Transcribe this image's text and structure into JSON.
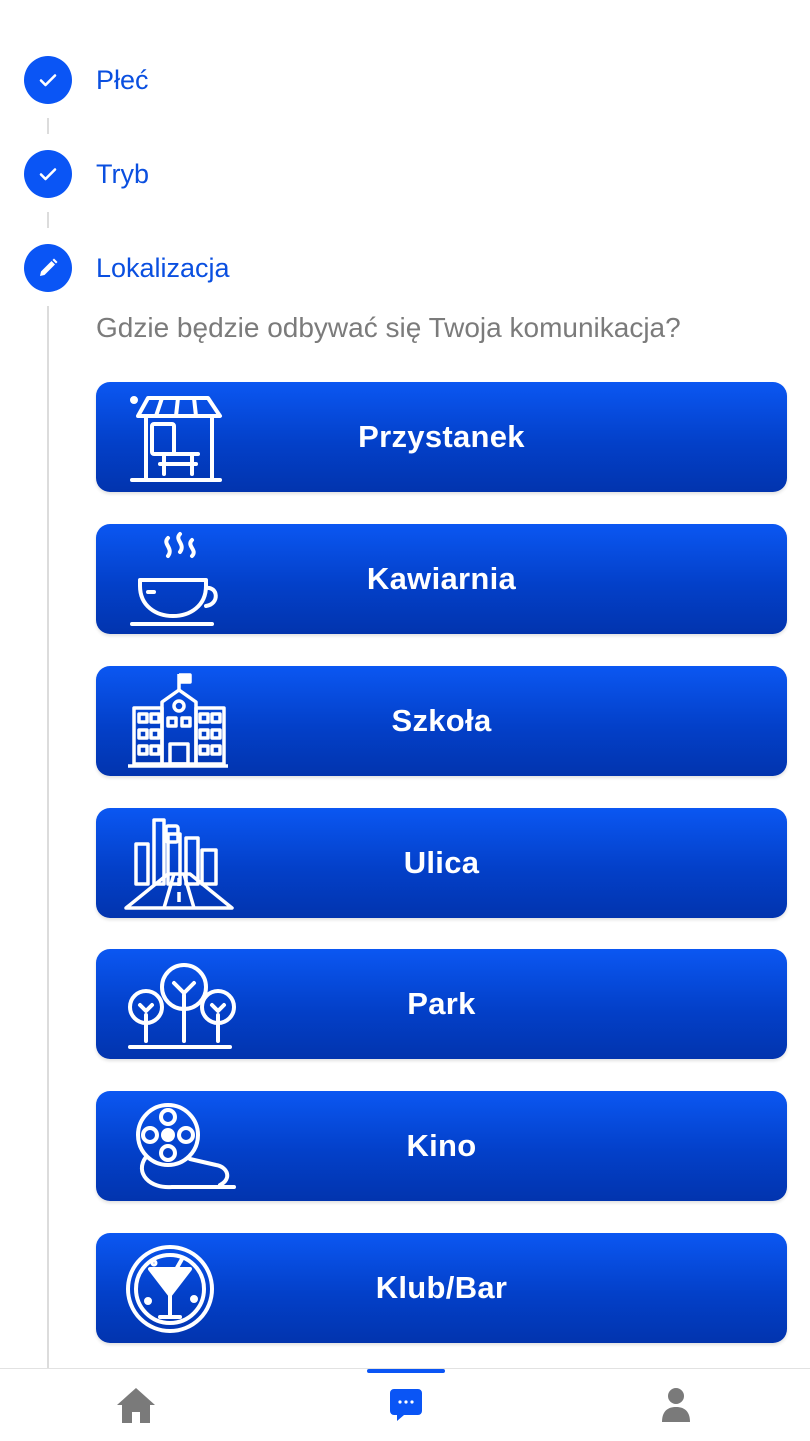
{
  "steps": [
    {
      "label": "Płeć",
      "state": "done",
      "icon": "check-icon"
    },
    {
      "label": "Tryb",
      "state": "done",
      "icon": "check-icon"
    },
    {
      "label": "Lokalizacja",
      "state": "current",
      "icon": "pencil-icon"
    }
  ],
  "question": "Gdzie będzie odbywać się Twoja komunikacja?",
  "options": [
    {
      "label": "Przystanek",
      "icon": "bus-stop-icon"
    },
    {
      "label": "Kawiarnia",
      "icon": "coffee-cup-icon"
    },
    {
      "label": "Szkoła",
      "icon": "school-building-icon"
    },
    {
      "label": "Ulica",
      "icon": "street-city-icon"
    },
    {
      "label": "Park",
      "icon": "park-trees-icon"
    },
    {
      "label": "Kino",
      "icon": "film-reel-icon"
    },
    {
      "label": "Klub/Bar",
      "icon": "cocktail-icon"
    }
  ],
  "nav": [
    {
      "name": "home",
      "icon": "home-icon",
      "active": false
    },
    {
      "name": "chat",
      "icon": "chat-bubble-icon",
      "active": true
    },
    {
      "name": "profile",
      "icon": "user-icon",
      "active": false
    }
  ],
  "colors": {
    "accent": "#0a55f5",
    "button_gradient_top": "#0b57f2",
    "button_gradient_bottom": "#0234ae",
    "question_text": "#7b7b7b",
    "nav_icon": "#7a7a7a"
  }
}
